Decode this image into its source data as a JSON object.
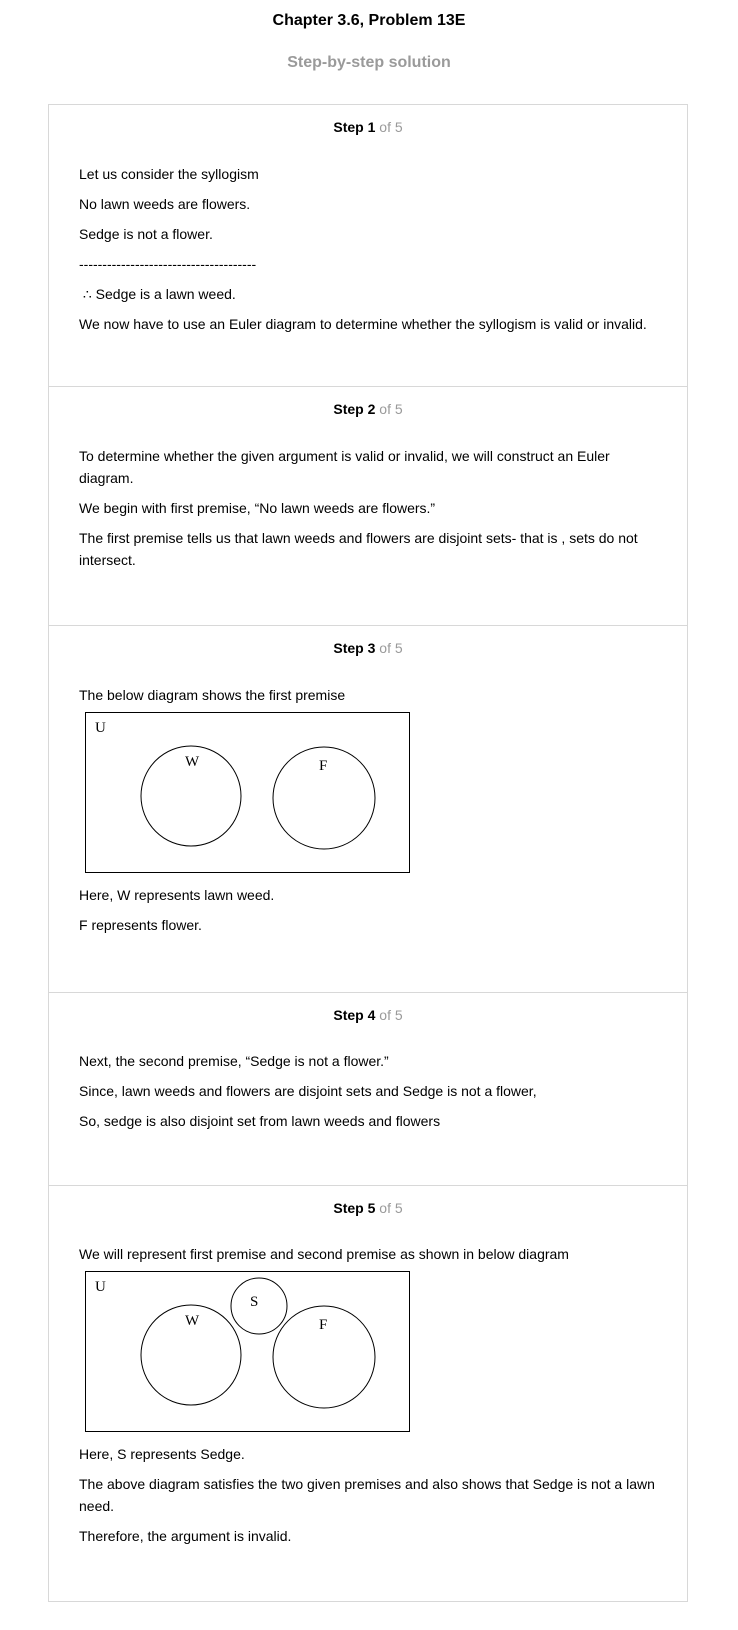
{
  "header": {
    "title": "Chapter 3.6, Problem 13E",
    "subtitle": "Step-by-step solution"
  },
  "step_word": "Step",
  "step_total": "of 5",
  "steps": [
    {
      "number": "1",
      "lines": [
        "Let us consider the syllogism",
        "No lawn weeds are flowers.",
        "Sedge is not a flower.",
        "--------------------------------------",
        " ∴ Sedge is a lawn weed.",
        "We now have to use an Euler diagram to determine whether the syllogism is valid or invalid."
      ]
    },
    {
      "number": "2",
      "lines": [
        "To determine whether the given argument is valid or invalid, we will construct an Euler diagram.",
        "We begin with first premise, “No lawn weeds are flowers.”",
        "The first premise tells us that lawn weeds and flowers are disjoint sets- that is , sets do not intersect."
      ]
    },
    {
      "number": "3",
      "intro": "The below diagram shows the first premise",
      "diagram_labels": {
        "universe": "U",
        "set1": "W",
        "set2": "F"
      },
      "lines": [
        "Here, W represents lawn weed.",
        "F represents flower."
      ]
    },
    {
      "number": "4",
      "lines": [
        "Next, the second premise, “Sedge is not a flower.”",
        "Since, lawn weeds and flowers are disjoint sets and Sedge is not a flower,",
        "So, sedge is also disjoint set from lawn weeds and flowers"
      ]
    },
    {
      "number": "5",
      "intro": "We will represent first premise and second premise as shown in below diagram",
      "diagram_labels": {
        "universe": "U",
        "set1": "W",
        "set2": "F",
        "set3": "S"
      },
      "lines": [
        "Here, S represents Sedge.",
        "The above diagram satisfies the two given premises and also shows that Sedge is not a lawn need.",
        "Therefore, the argument is invalid."
      ]
    }
  ]
}
